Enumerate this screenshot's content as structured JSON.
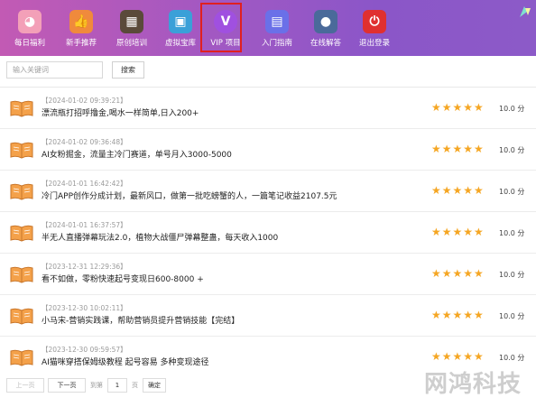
{
  "nav": {
    "items": [
      {
        "label": "每日福利",
        "icon": "cat-face-icon",
        "color": "#f3a0b8"
      },
      {
        "label": "新手推荐",
        "icon": "thumbs-up-icon",
        "color": "#f08a3c"
      },
      {
        "label": "原创培训",
        "icon": "chalkboard-icon",
        "color": "#5a4a3a"
      },
      {
        "label": "虚拟宝库",
        "icon": "treasure-box-icon",
        "color": "#3aa0d8"
      },
      {
        "label": "VIP 项目",
        "icon": "vip-badge-icon",
        "color": "#a050e0"
      },
      {
        "label": "入门指南",
        "icon": "guide-book-icon",
        "color": "#6a70e8"
      },
      {
        "label": "在线解答",
        "icon": "support-agent-icon",
        "color": "#4a6a9a"
      },
      {
        "label": "退出登录",
        "icon": "power-icon",
        "color": "#e03030"
      }
    ]
  },
  "search": {
    "placeholder": "输入关键词",
    "button": "搜索"
  },
  "list": [
    {
      "date": "【2024-01-02 09:39:21】",
      "title": "漂流瓶打招呼撸金,喝水一样简单,日入200+",
      "rating": 5,
      "score": "10.0 分"
    },
    {
      "date": "【2024-01-02 09:36:48】",
      "title": "AI女粉掘金，流量主冷门赛道，单号月入3000-5000",
      "rating": 5,
      "score": "10.0 分"
    },
    {
      "date": "【2024-01-01 16:42:42】",
      "title": "冷门APP创作分成计划，最新风口，做第一批吃螃蟹的人，一篇笔记收益2107.5元",
      "rating": 5,
      "score": "10.0 分"
    },
    {
      "date": "【2024-01-01 16:37:57】",
      "title": "半无人直播弹幕玩法2.0，植物大战僵尸弹幕整蛊，每天收入1000",
      "rating": 5,
      "score": "10.0 分"
    },
    {
      "date": "【2023-12-31 12:29:36】",
      "title": "看不如做，零粉快速起号变现日600-8000 +",
      "rating": 5,
      "score": "10.0 分"
    },
    {
      "date": "【2023-12-30 10:02:11】",
      "title": "小马宋-营销实践课，帮助营销员提升营销技能【完结】",
      "rating": 5,
      "score": "10.0 分"
    },
    {
      "date": "【2023-12-30 09:59:57】",
      "title": "AI猫咪穿搭保姆级教程 起号容易 多种变现途径",
      "rating": 5,
      "score": "10.0 分"
    }
  ],
  "pager": {
    "prev": "上一页",
    "next": "下一页",
    "goto": "到第",
    "page": "1",
    "page_unit": "页",
    "confirm": "确定"
  },
  "watermark": "网鸿科技"
}
